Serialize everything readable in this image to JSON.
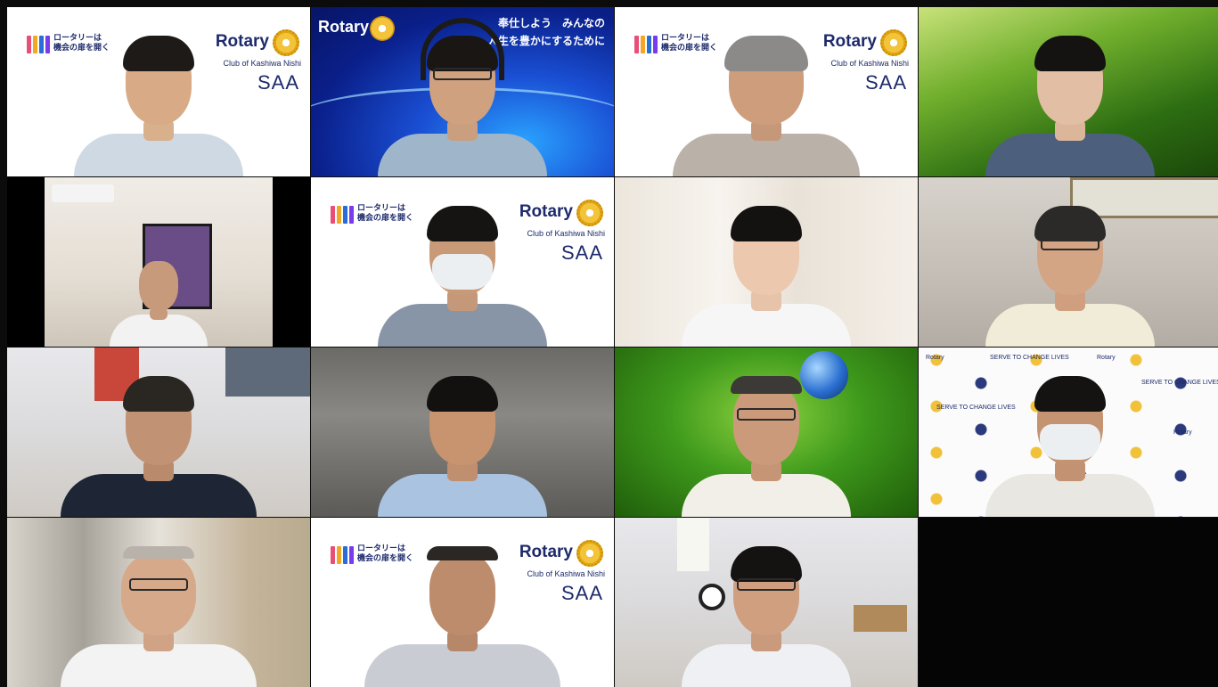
{
  "meeting": {
    "layout": "gallery-4x4",
    "participant_count": 15
  },
  "branding": {
    "jp_line1": "ロータリーは",
    "jp_line2": "機会の扉を開く",
    "rotary": "Rotary",
    "club": "Club of Kashiwa Nishi",
    "saa": "SAA"
  },
  "banner": {
    "rotary": "Rotary",
    "slogan_line1": "奉仕しよう　みんなの",
    "slogan_line2": "人生を豊かにするために"
  },
  "backdrop": {
    "serve_text": "SERVE TO CHANGE LIVES",
    "rotary": "Rotary"
  },
  "colors": {
    "brand_navy": "#1d2a6b",
    "rotary_gold": "#f3c33a",
    "grid_gap": "#0c0c0c"
  },
  "tiles": [
    {
      "background": "rotary-saa",
      "mask": false,
      "headset": false,
      "glasses": false
    },
    {
      "background": "rotary-blue-banner",
      "mask": false,
      "headset": true,
      "glasses": true
    },
    {
      "background": "rotary-saa",
      "mask": false,
      "headset": false,
      "glasses": false
    },
    {
      "background": "grass-field",
      "mask": false,
      "headset": false,
      "glasses": false
    },
    {
      "background": "room-with-painting",
      "mask": false,
      "headset": false,
      "glasses": false
    },
    {
      "background": "rotary-saa",
      "mask": true,
      "headset": true,
      "glasses": false
    },
    {
      "background": "curtain",
      "mask": false,
      "headset": false,
      "glasses": false
    },
    {
      "background": "room-with-frame",
      "mask": false,
      "headset": false,
      "glasses": true
    },
    {
      "background": "office-posters",
      "mask": false,
      "headset": false,
      "glasses": false
    },
    {
      "background": "dark-wall",
      "mask": false,
      "headset": false,
      "glasses": false
    },
    {
      "background": "green-leaf-globe",
      "mask": false,
      "headset": false,
      "glasses": true
    },
    {
      "background": "rotary-backdrop",
      "mask": true,
      "headset": false,
      "glasses": false
    },
    {
      "background": "blurred-room",
      "mask": false,
      "headset": false,
      "glasses": true
    },
    {
      "background": "rotary-saa",
      "mask": false,
      "headset": false,
      "glasses": false
    },
    {
      "background": "office-clock",
      "mask": false,
      "headset": false,
      "glasses": true
    },
    {
      "background": "empty",
      "mask": false,
      "headset": false,
      "glasses": false
    }
  ]
}
